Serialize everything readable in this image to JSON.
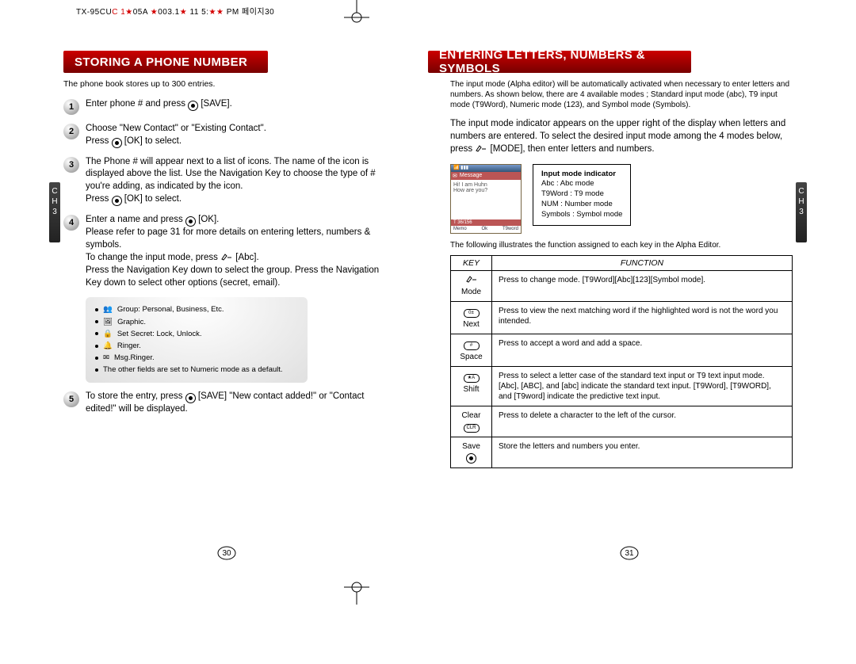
{
  "slug": {
    "a": "TX-95CU",
    "b": "C 1",
    "c": "05A  ",
    "d": "003.1",
    "e": "  11  5:",
    "f": " PM  페이지",
    "g": "30"
  },
  "chapter_tab": {
    "line1": "C",
    "line2": "H",
    "line3": "3"
  },
  "left_page": {
    "banner": "Storing a Phone Number",
    "intro": "The phone book stores up to 300 entries.",
    "steps": {
      "1": "Enter phone # and press  ⊙ [SAVE].",
      "2": "Choose \"New Contact\" or \"Existing Contact\". Press ⊙ [OK] to select.",
      "3": "The Phone # will appear next to a list of icons. The name of the icon is displayed above the list. Use the Navigation Key to choose the type of # you're adding, as indicated by the icon. Press ⊙ [OK] to select.",
      "4": "Enter a name and press ⊙ [OK]. Please refer to page 31 for more details on entering letters, numbers & symbols. To change the input mode, press ✎ [Abc]. Press the Navigation Key down to select the group. Press the Navigation Key down to select other options (secret, email).",
      "5": "To store the entry, press ⊙ [SAVE] \"New contact added!\" or \"Contact edited!\" will be displayed."
    },
    "options": {
      "o1": "Group: Personal, Business, Etc.",
      "o2": "Graphic.",
      "o3": "Set Secret: Lock, Unlock.",
      "o4": "Ringer.",
      "o5": "Msg.Ringer.",
      "o6": "The other fields are set to Numeric mode as a default."
    },
    "pagenum": "30"
  },
  "right_page": {
    "banner": "Entering Letters, Numbers & Symbols",
    "intro": "The input mode (Alpha editor) will be automatically activated when necessary to enter letters and numbers. As shown below, there are 4 available modes ; Standard input mode (abc), T9 input mode (T9Word), Numeric mode (123), and Symbol mode (Symbols).",
    "para": "The input mode indicator appears on the upper right of the display when letters and numbers are entered. To select the desired input mode among the 4 modes below, press ✎ [MODE], then enter letters and numbers.",
    "screen": {
      "title": "Message",
      "body1": "Hi! I am Huhn",
      "body2": "How are you?",
      "count": "T 36/156",
      "soft_l": "Memo",
      "soft_m": "Ok",
      "soft_r": "T9word"
    },
    "legend": {
      "hdr": "Input mode indicator",
      "l1": "Abc : Abc mode",
      "l2": "T9Word : T9 mode",
      "l3": "NUM : Number mode",
      "l4": "Symbols : Symbol mode"
    },
    "table_intro": "The following illustrates the function assigned to each key in the Alpha Editor.",
    "table": {
      "h1": "KEY",
      "h2": "FUNCTION",
      "r1k": "Mode",
      "r1f": "Press to change mode. [T9Word][Abc][123][Symbol mode].",
      "r2k": "Next",
      "r2f": "Press to view the next matching word if the highlighted word is not the word you intended.",
      "r3k": "Space",
      "r3f": "Press to accept a word and add a space.",
      "r4k": "Shift",
      "r4f": "Press to select a letter case of the standard text input or T9 text input mode. [Abc], [ABC], and [abc] indicate the standard text input. [T9Word], [T9WORD], and [T9word] indicate the predictive text input.",
      "r5k": "Clear",
      "r5f": "Press to delete a character to the left of the cursor.",
      "r6k": "Save",
      "r6f": "Store the letters and numbers you enter."
    },
    "pagenum": "31"
  }
}
